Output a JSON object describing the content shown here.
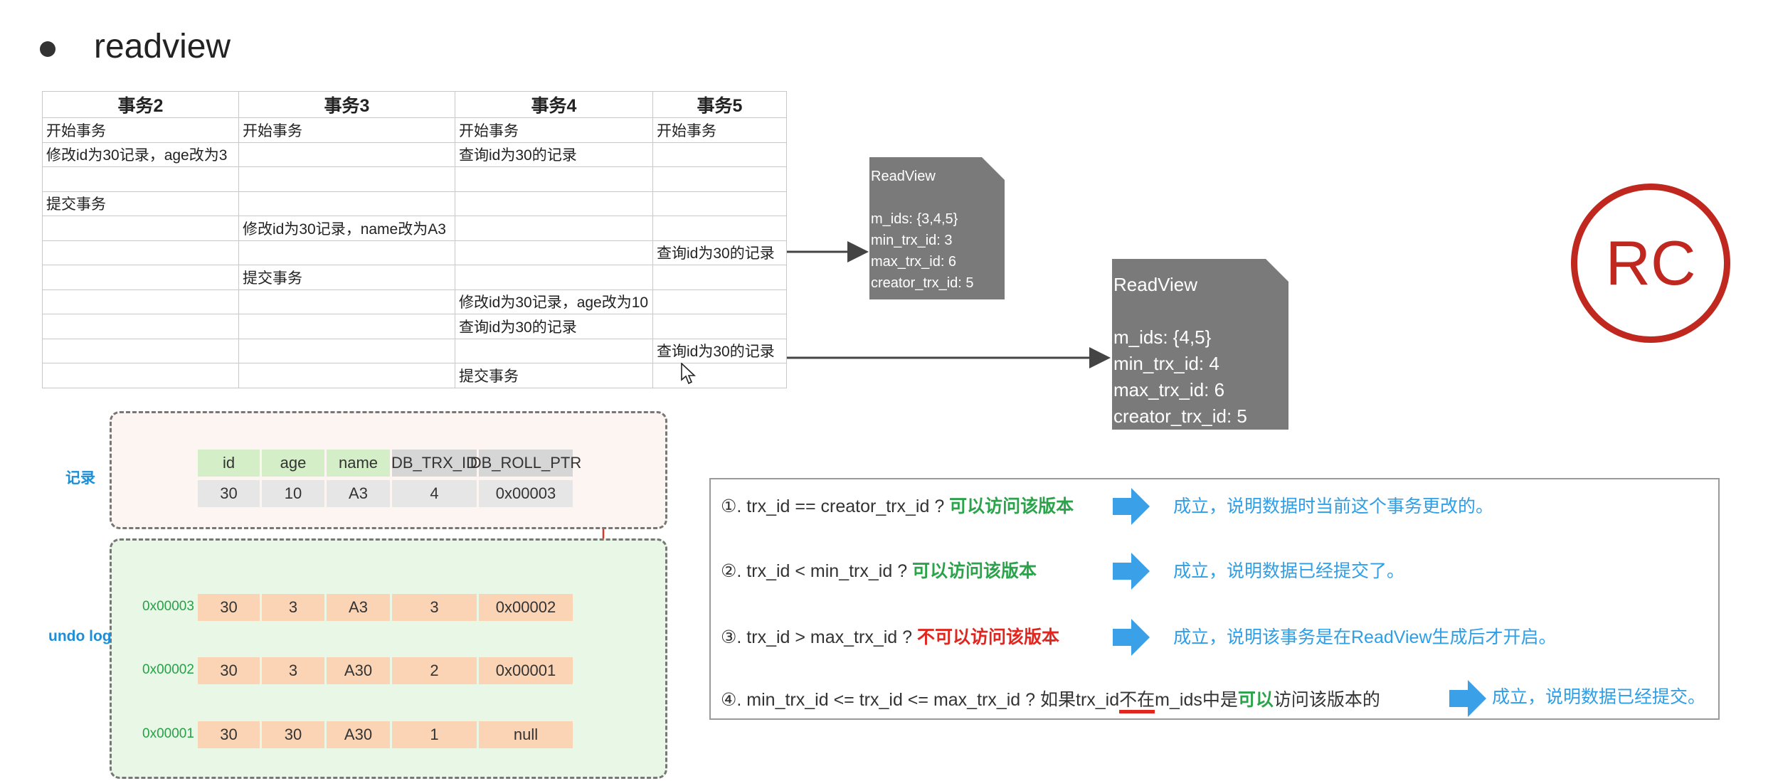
{
  "title": "readview",
  "table": {
    "headers": [
      "事务2",
      "事务3",
      "事务4",
      "事务5"
    ],
    "rows": [
      [
        "开始事务",
        "开始事务",
        "开始事务",
        "开始事务"
      ],
      [
        "修改id为30记录，age改为3",
        "",
        "查询id为30的记录",
        ""
      ],
      [
        "",
        "",
        "",
        ""
      ],
      [
        "提交事务",
        "",
        "",
        ""
      ],
      [
        "",
        "修改id为30记录，name改为A3",
        "",
        ""
      ],
      [
        "",
        "",
        "",
        "查询id为30的记录"
      ],
      [
        "",
        "提交事务",
        "",
        ""
      ],
      [
        "",
        "",
        "修改id为30记录，age改为10",
        ""
      ],
      [
        "",
        "",
        "查询id为30的记录",
        ""
      ],
      [
        "",
        "",
        "",
        "查询id为30的记录"
      ],
      [
        "",
        "",
        "提交事务",
        ""
      ]
    ]
  },
  "readview1": {
    "title": "ReadView",
    "m_ids": "m_ids: {3,4,5}",
    "min_trx_id": "min_trx_id: 3",
    "max_trx_id": "max_trx_id: 6",
    "creator_trx_id": "creator_trx_id: 5"
  },
  "readview2": {
    "title": "ReadView",
    "m_ids": "m_ids: {4,5}",
    "min_trx_id": "min_trx_id: 4",
    "max_trx_id": "max_trx_id: 6",
    "creator_trx_id": "creator_trx_id: 5"
  },
  "rc_label": "RC",
  "record": {
    "label": "记录",
    "headers": [
      "id",
      "age",
      "name",
      "DB_TRX_ID",
      "DB_ROLL_PTR"
    ],
    "values": [
      "30",
      "10",
      "A3",
      "4",
      "0x00003"
    ]
  },
  "undo_log": {
    "label": "undo log",
    "rows": [
      {
        "addr": "0x00003",
        "values": [
          "30",
          "3",
          "A3",
          "3",
          "0x00002"
        ]
      },
      {
        "addr": "0x00002",
        "values": [
          "30",
          "3",
          "A30",
          "2",
          "0x00001"
        ]
      },
      {
        "addr": "0x00001",
        "values": [
          "30",
          "30",
          "A30",
          "1",
          "null"
        ]
      }
    ]
  },
  "rules": {
    "r1": {
      "text": "①. trx_id  == creator_trx_id ? ",
      "verdict": "可以访问该版本",
      "result": "成立，说明数据时当前这个事务更改的。"
    },
    "r2": {
      "text": "②. trx_id < min_trx_id ? ",
      "verdict": "可以访问该版本",
      "result": "成立，说明数据已经提交了。"
    },
    "r3": {
      "text": "③. trx_id > max_trx_id ?  ",
      "verdict": "不可以访问该版本",
      "result": "成立，说明该事务是在ReadView生成后才开启。"
    },
    "r4": {
      "text_a": "④. min_trx_id <= trx_id <= max_trx_id ?  如果trx_id",
      "not_in": "不在",
      "text_b": "m_ids中是",
      "can": "可以",
      "text_c": "访问该版本的",
      "result": "成立，说明数据已经提交。"
    }
  },
  "colors": {
    "accent_red": "#c0281f",
    "blue": "#2e9ee6",
    "green": "#2aa34a",
    "card_gray": "#7a7a7a"
  }
}
